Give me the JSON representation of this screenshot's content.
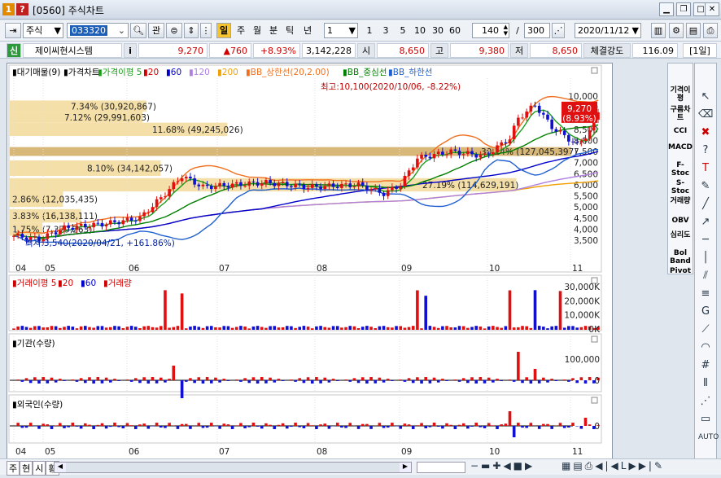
{
  "titlebar": {
    "icon1": "1",
    "icon2": "?",
    "title": "[0560] 주식차트",
    "buttons": [
      "minimize-icon",
      "restore-icon",
      "close-icon"
    ]
  },
  "toolbar": {
    "market": "주식",
    "code": "033320",
    "gwan": "관",
    "period_labels": [
      "일",
      "주",
      "월",
      "분",
      "틱",
      "년"
    ],
    "active_period": "일",
    "interval_select": "1",
    "intervals": [
      "1",
      "3",
      "5",
      "10",
      "30",
      "60"
    ],
    "count": "140",
    "slash": "/",
    "total": "300",
    "date": "2020/11/12"
  },
  "quote": {
    "badge": "신",
    "name": "제이씨현시스템",
    "info": "i",
    "price": "9,270",
    "change": "▲760",
    "pct": "+8.93%",
    "volume": "3,142,228",
    "open_lbl": "시",
    "open": "8,650",
    "high_lbl": "고",
    "high": "9,380",
    "low_lbl": "저",
    "low": "8,650",
    "strength_lbl": "체결강도",
    "strength": "116.09",
    "period_box": "[1일]"
  },
  "price_panel": {
    "legend": [
      "대기매물(9)",
      "가격차트",
      "가격이평 5",
      "20",
      "60",
      "120",
      "200",
      "BB_상한선(20,2.00)",
      "BB_중심선",
      "BB_하한선"
    ],
    "legend_colors": [
      "#000000",
      "#000000",
      "#1a9e1a",
      "#d00000",
      "#0000cc",
      "#b080e0",
      "#f0a000",
      "#f07020",
      "#008000",
      "#2060d0"
    ],
    "annot_high": "최고:10,100(2020/10/06, -8.22%)",
    "annot_low": "최저:3,540(2020/04/21, +161.86%)",
    "last_price": "9,270",
    "last_pct": "(8.93%)",
    "y_ticks": [
      "10,000",
      "9,500",
      "9,000",
      "8,500",
      "8,000",
      "7,500",
      "7,000",
      "6,500",
      "6,000",
      "5,500",
      "5,000",
      "4,500",
      "4,000",
      "3,500"
    ],
    "profile": [
      {
        "label": "7.34% (30,920,867)",
        "pct": 7.34
      },
      {
        "label": "7.12% (29,991,603)",
        "pct": 7.12
      },
      {
        "label": "11.68% (49,245,026)",
        "pct": 11.68
      },
      {
        "label": "30.14% (127,045,397)",
        "pct": 30.14
      },
      {
        "label": "8.10% (34,142,057)",
        "pct": 8.1
      },
      {
        "label": "27.19% (114,629,191)",
        "pct": 27.19
      },
      {
        "label": "2.86% (12,035,435)",
        "pct": 2.86
      },
      {
        "label": "3.83% (16,138,111)",
        "pct": 3.83
      },
      {
        "label": "1.75% (7,379,263)",
        "pct": 1.75
      }
    ]
  },
  "x_ticks": [
    "04",
    "05",
    "06",
    "07",
    "08",
    "09",
    "10",
    "11"
  ],
  "volume_panel": {
    "legend": [
      "거래이평 5",
      "20",
      "60",
      "거래량"
    ],
    "y_ticks": [
      "30,000K",
      "20,000K",
      "10,000K",
      "0K"
    ]
  },
  "inst_panel": {
    "legend": "기관(수량)",
    "y_ticks": [
      "100,000",
      "0"
    ]
  },
  "foreign_panel": {
    "legend": "외국인(수량)",
    "y_ticks": [
      "0"
    ]
  },
  "right_panel": {
    "items": [
      "기격이평",
      "구름차트",
      "CCI",
      "MACD",
      "F-Stoc",
      "S-Stoc",
      "거래량",
      "OBV",
      "심리도",
      "Bol Band",
      "Pivot"
    ]
  },
  "bottom": {
    "tabs": [
      "주",
      "현",
      "시",
      "황"
    ]
  },
  "colors": {
    "up": "#e01010",
    "down": "#1010d0",
    "profile": "#f5dfa8",
    "profile_max": "#d8b878"
  }
}
